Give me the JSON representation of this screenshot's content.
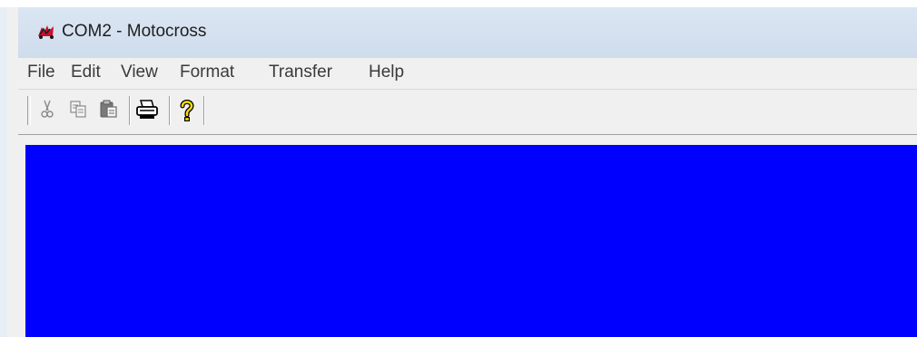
{
  "window": {
    "title": "COM2 - Motocross",
    "icon": "hyperterminal-app-icon"
  },
  "menubar": {
    "items": [
      "File",
      "Edit",
      "View",
      "Format",
      "Transfer",
      "Help"
    ]
  },
  "toolbar": {
    "buttons": [
      {
        "name": "cut",
        "icon": "scissors-icon"
      },
      {
        "name": "copy",
        "icon": "copy-icon"
      },
      {
        "name": "paste",
        "icon": "paste-icon"
      },
      {
        "name": "print",
        "icon": "printer-icon"
      },
      {
        "name": "help",
        "icon": "question-mark-icon"
      }
    ]
  },
  "terminal": {
    "background_color": "#0000ff"
  }
}
